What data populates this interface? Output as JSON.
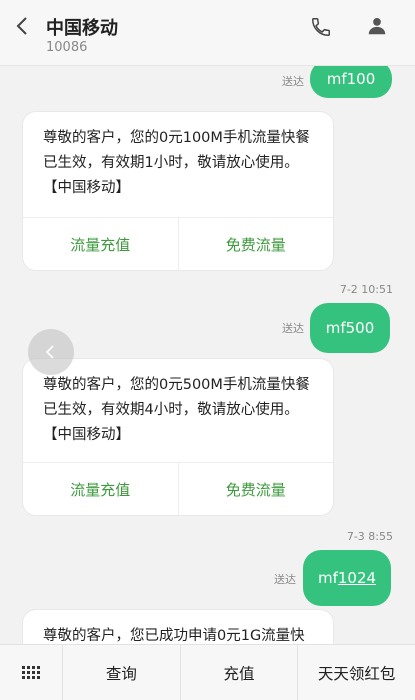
{
  "header": {
    "title": "中国移动",
    "number": "10086"
  },
  "messages": [
    {
      "type": "out",
      "text": "mf100",
      "status": "送达"
    },
    {
      "type": "in",
      "text": "尊敬的客户，您的0元100M手机流量快餐\n已生效，有效期1小时，敬请放心使用。\n【中国移动】",
      "actions": [
        "流量充值",
        "免费流量"
      ]
    },
    {
      "type": "time",
      "text": "7-2 10:51"
    },
    {
      "type": "out",
      "text": "mf500",
      "status": "送达"
    },
    {
      "type": "in",
      "text": "尊敬的客户，您的0元500M手机流量快餐\n已生效，有效期4小时，敬请放心使用。\n【中国移动】",
      "actions": [
        "流量充值",
        "免费流量"
      ]
    },
    {
      "type": "time",
      "text": "7-3 8:55"
    },
    {
      "type": "out",
      "text_prefix": "mf",
      "text_link": "1024",
      "status": "送达"
    },
    {
      "type": "in",
      "text": "尊敬的客户，您已成功申请0元1G流量快"
    }
  ],
  "bottom_bar": {
    "items": [
      "查询",
      "充值",
      "天天领红包"
    ]
  },
  "colors": {
    "accent_green": "#34c27e",
    "action_green": "#3d9a3d"
  }
}
